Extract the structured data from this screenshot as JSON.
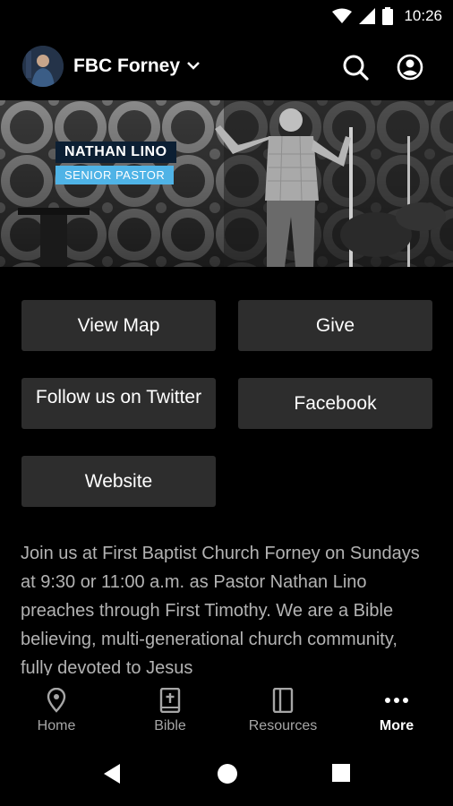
{
  "status_bar": {
    "time": "10:26",
    "icons": [
      "wifi-icon",
      "signal-icon",
      "battery-icon"
    ]
  },
  "header": {
    "title": "FBC Forney",
    "icons": [
      "chevron-down-icon",
      "search-icon",
      "account-icon"
    ]
  },
  "hero": {
    "name": "NATHAN LINO",
    "role": "SENIOR PASTOR"
  },
  "buttons": {
    "view_map": "View Map",
    "give": "Give",
    "twitter": "Follow us on Twitter",
    "facebook": "Facebook",
    "website": "Website"
  },
  "description": "Join us at First Baptist Church Forney on Sundays at 9:30 or 11:00 a.m. as Pastor Nathan Lino preaches through First Timothy. We are a Bible believing, multi-generational church community, fully devoted to Jesus",
  "bottom_nav": {
    "items": [
      {
        "label": "Home",
        "icon": "location-pin-icon",
        "active": false
      },
      {
        "label": "Bible",
        "icon": "bible-icon",
        "active": false
      },
      {
        "label": "Resources",
        "icon": "resources-icon",
        "active": false
      },
      {
        "label": "More",
        "icon": "more-dots-icon",
        "active": true
      }
    ]
  },
  "system_nav": {
    "icons": [
      "back-icon",
      "home-circle-icon",
      "recents-icon"
    ]
  },
  "colors": {
    "background": "#000000",
    "button": "#2d2d2d",
    "name_tag": "#0c1f33",
    "role_tag": "#4fb3e6",
    "text_muted": "#b3b3b3"
  }
}
